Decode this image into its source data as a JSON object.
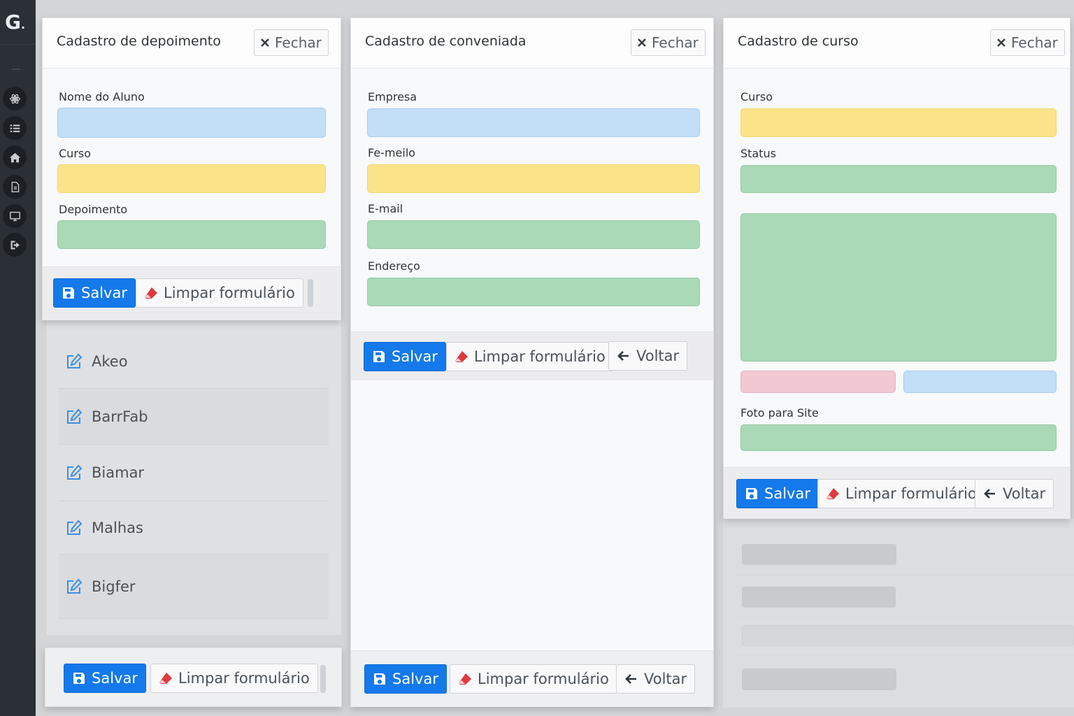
{
  "sidebar": {
    "logo": "G",
    "logo_mark": ".",
    "items": [
      {
        "icon": "atom-icon"
      },
      {
        "icon": "list-icon"
      },
      {
        "icon": "home-icon"
      },
      {
        "icon": "document-icon"
      },
      {
        "icon": "monitor-icon"
      },
      {
        "icon": "sign-out-icon"
      }
    ]
  },
  "common": {
    "close_label": "Fechar",
    "save_label": "Salvar",
    "clear_label": "Limpar formulário",
    "back_label": "Voltar"
  },
  "depoimento": {
    "title": "Cadastro de depoimento",
    "fields": {
      "aluno": "Nome do Aluno",
      "curso": "Curso",
      "depoimento": "Depoimento"
    },
    "list": [
      "Akeo",
      "BarrFab",
      "Biamar",
      "Malhas",
      "Bigfer"
    ]
  },
  "conveniada": {
    "title": "Cadastro de conveniada",
    "fields": {
      "empresa": "Empresa",
      "femeilo": "Fe-meilo",
      "email": "E-mail",
      "endereco": "Endereço"
    }
  },
  "curso": {
    "title": "Cadastro de curso",
    "fields": {
      "curso": "Curso",
      "status": "Status",
      "foto": "Foto para Site"
    }
  },
  "colors": {
    "primary": "#1479ea",
    "field_blue": "#c3def7",
    "field_yellow": "#fbe38a",
    "field_green": "#a9d9b7",
    "field_pink": "#f2c8d3",
    "sidebar": "#2b3036"
  }
}
